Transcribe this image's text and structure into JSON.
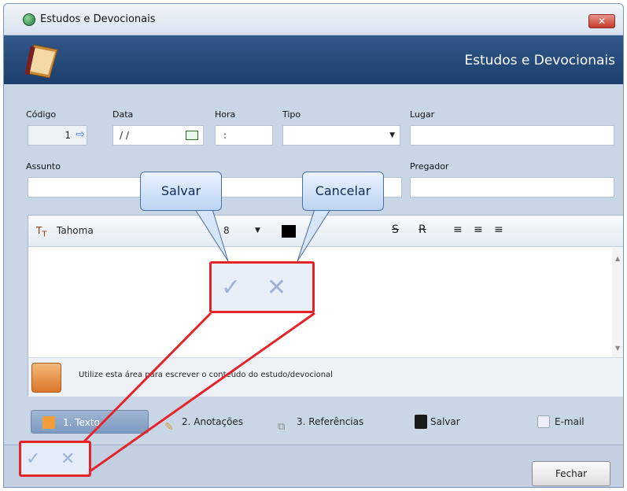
{
  "window": {
    "title": "Estudos e Devocionais",
    "close_label": "✕"
  },
  "banner": {
    "title": "Estudos e Devocionais"
  },
  "form": {
    "codigo": {
      "label": "Código",
      "value": "1"
    },
    "data": {
      "label": "Data",
      "value": "/ /"
    },
    "hora": {
      "label": "Hora",
      "value": ":"
    },
    "tipo": {
      "label": "Tipo",
      "value": ""
    },
    "lugar": {
      "label": "Lugar",
      "value": ""
    },
    "assunto": {
      "label": "Assunto",
      "value": ""
    },
    "pregador": {
      "label": "Pregador",
      "value": ""
    }
  },
  "toolbar": {
    "font_name": "Tahoma",
    "font_size": "8",
    "strike_label": "S",
    "r_label": "R"
  },
  "editor": {
    "hint": "Utilize esta área para escrever o conteúdo do estudo/devocional"
  },
  "tabs": [
    {
      "label": "1. Texto"
    },
    {
      "label": "2. Anotações"
    },
    {
      "label": "3. Referências"
    },
    {
      "label": "Salvar"
    },
    {
      "label": "E-mail"
    }
  ],
  "buttons": {
    "fechar": "Fechar"
  },
  "callouts": {
    "salvar": "Salvar",
    "cancelar": "Cancelar"
  },
  "colors": {
    "banner": "#1c3f6d",
    "highlight_border": "#e4242a"
  },
  "icons": {
    "confirm": "check-icon",
    "cancel": "x-icon"
  }
}
